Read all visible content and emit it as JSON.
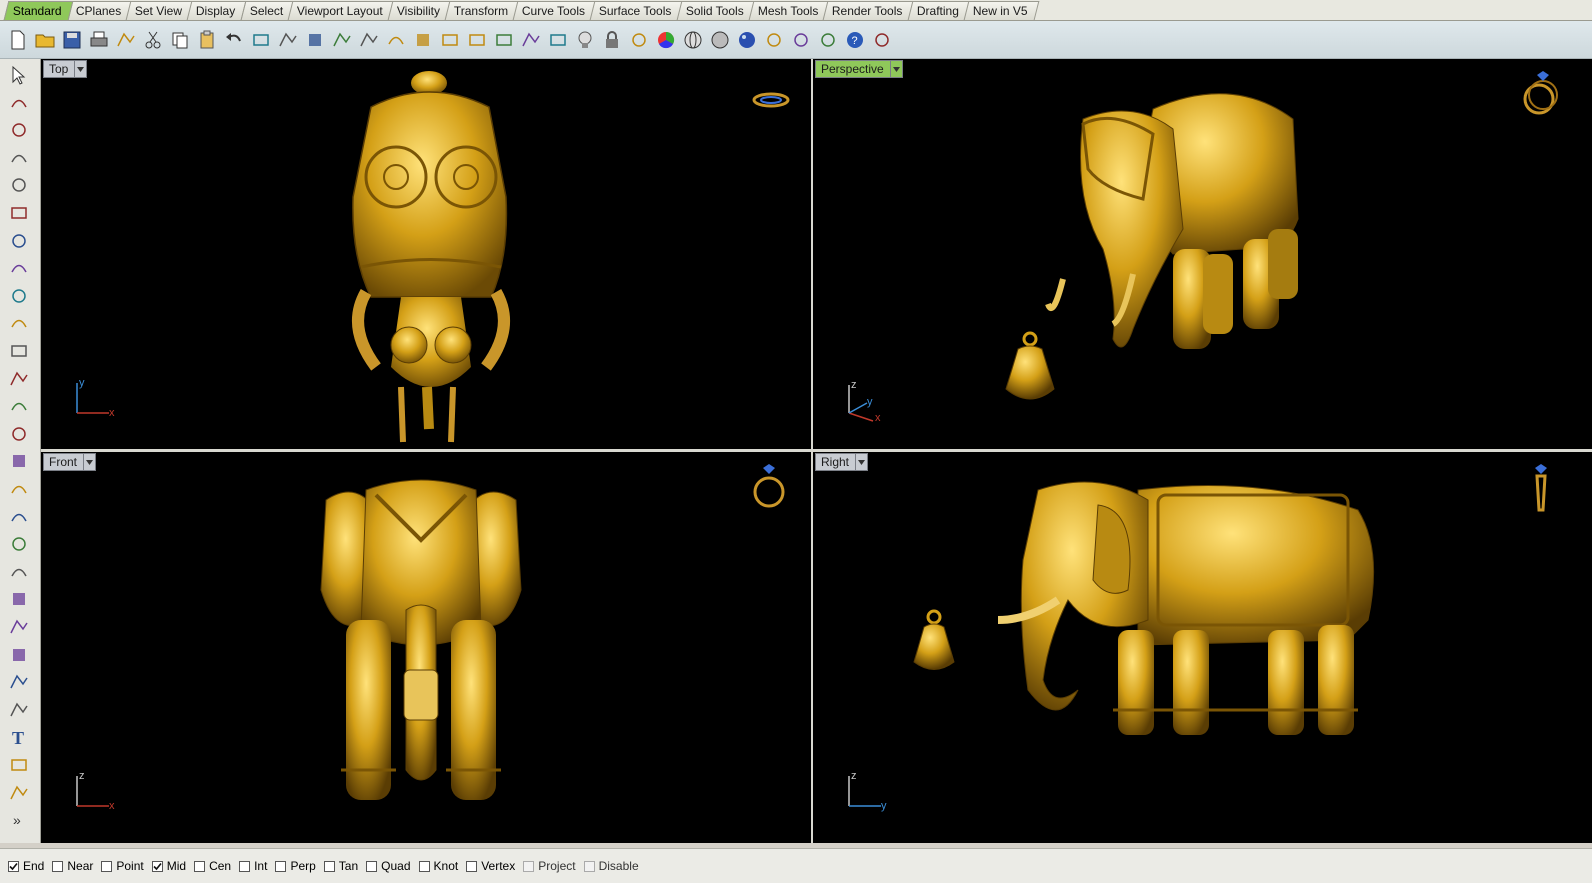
{
  "tabs": [
    {
      "label": "Standard",
      "active": true
    },
    {
      "label": "CPlanes"
    },
    {
      "label": "Set View"
    },
    {
      "label": "Display"
    },
    {
      "label": "Select"
    },
    {
      "label": "Viewport Layout"
    },
    {
      "label": "Visibility"
    },
    {
      "label": "Transform"
    },
    {
      "label": "Curve Tools"
    },
    {
      "label": "Surface Tools"
    },
    {
      "label": "Solid Tools"
    },
    {
      "label": "Mesh Tools"
    },
    {
      "label": "Render Tools"
    },
    {
      "label": "Drafting"
    },
    {
      "label": "New in V5"
    }
  ],
  "toolbar_icons": [
    "new-file-icon",
    "open-folder-icon",
    "save-icon",
    "print-icon",
    "import-icon",
    "cut-icon",
    "copy-icon",
    "paste-icon",
    "undo-icon",
    "pan-hand-icon",
    "move-view-icon",
    "zoom-in-icon",
    "zoom-window-icon",
    "zoom-extents-icon",
    "zoom-selected-icon",
    "rotate-view-icon",
    "four-viewports-icon",
    "car-icon",
    "named-views-icon",
    "cplane-icon",
    "snapshot-icon",
    "light-bulb-icon",
    "lock-icon",
    "layer-icon",
    "color-wheel-icon",
    "sphere-wire-icon",
    "sphere-shaded-icon",
    "sphere-rendered-icon",
    "filter-icon",
    "settings-gear-icon",
    "dimension-icon",
    "help-icon",
    "tools-icon"
  ],
  "sidebar_icons": [
    "select-arrow-icon",
    "point-icon",
    "polyline-icon",
    "curve-icon",
    "circle-icon",
    "ellipse-icon",
    "polygon-icon",
    "rectangle-icon",
    "polygon-hex-icon",
    "fillet-curve-icon",
    "surface-icon",
    "surface-edit-icon",
    "box-icon",
    "boolean-icon",
    "cylinder-icon",
    "mesh-icon",
    "gear-parts-icon",
    "analyze-icon",
    "trim-icon",
    "extend-icon",
    "group-icon",
    "array-icon",
    "blend-icon",
    "offset-icon",
    "text-icon",
    "scale-icon",
    "grid-icon",
    "more-icon"
  ],
  "viewports": {
    "top": {
      "label": "Top",
      "axis_v": "y",
      "axis_h": "x"
    },
    "perspective": {
      "label": "Perspective",
      "axis_v": "z",
      "axis_h": "x",
      "axis_d": "y"
    },
    "front": {
      "label": "Front",
      "axis_v": "z",
      "axis_h": "x"
    },
    "right": {
      "label": "Right",
      "axis_v": "z",
      "axis_h": "y"
    }
  },
  "osnaps": [
    {
      "label": "End",
      "checked": true
    },
    {
      "label": "Near",
      "checked": false
    },
    {
      "label": "Point",
      "checked": false
    },
    {
      "label": "Mid",
      "checked": true
    },
    {
      "label": "Cen",
      "checked": false
    },
    {
      "label": "Int",
      "checked": false
    },
    {
      "label": "Perp",
      "checked": false
    },
    {
      "label": "Tan",
      "checked": false
    },
    {
      "label": "Quad",
      "checked": false
    },
    {
      "label": "Knot",
      "checked": false
    },
    {
      "label": "Vertex",
      "checked": false
    },
    {
      "label": "Project",
      "checked": false,
      "disabled": true
    },
    {
      "label": "Disable",
      "checked": false,
      "disabled": true
    }
  ],
  "colors": {
    "active_tab": "#8fc85a",
    "gold": "#d4a017",
    "viewport_bg": "#000000",
    "axis_x": "#c0392b",
    "axis_y": "#3b8ed8"
  }
}
